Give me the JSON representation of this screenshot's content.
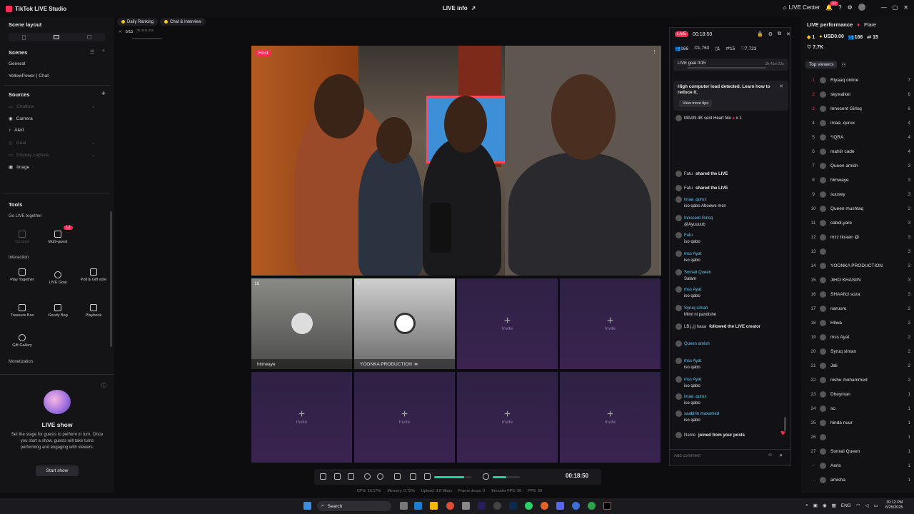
{
  "app": {
    "title": "TikTok LIVE Studio",
    "center_title": "LIVE info",
    "live_center": "LIVE Center",
    "notif_count": "11"
  },
  "left": {
    "scene_layout": "Scene layout",
    "scenes_title": "Scenes",
    "scenes": [
      "General",
      "YellowPower | Chat"
    ],
    "sources_title": "Sources",
    "sources": [
      {
        "label": "Chatbox",
        "dim": true
      },
      {
        "label": "Camera",
        "dim": false
      },
      {
        "label": "Alert",
        "dim": false
      },
      {
        "label": "Goal",
        "dim": true
      },
      {
        "label": "Display capture",
        "dim": true
      },
      {
        "label": "Image",
        "dim": false
      }
    ],
    "tools_title": "Tools",
    "go_live_together": "Go LIVE together",
    "cohost": "Co-host",
    "multiguest": "Multi-guest",
    "multiguest_badge": "12",
    "interaction": "Interaction",
    "play_together": "Play Together",
    "live_goal": "LIVE Goal",
    "poll_gift_vote": "Poll & Gift vote",
    "treasure_box": "Treasure Box",
    "goody_bag": "Goody Bag",
    "playbook": "Playbook",
    "gift_gallery": "Gift Gallery",
    "monetization": "Monetization",
    "live_show_title": "LIVE show",
    "live_show_desc": "Set the stage for guests to perform in turn. Once you start a show, guests will take turns performing and engaging with viewers.",
    "start_show": "Start show"
  },
  "top": {
    "daily_ranking": "Daily Ranking",
    "chat_interview": "Chat & Interview",
    "goal_progress": "0/15",
    "goal_time": "3h 41m 23s"
  },
  "video": {
    "host_label": "Host"
  },
  "guests": [
    {
      "name": "himwaye",
      "count": "16"
    },
    {
      "name": "YOONKA PRODUCTION 📼",
      "count": "6"
    }
  ],
  "invite_label": "Invite",
  "controls": {
    "timer": "00:18:50",
    "mic_level": 0.5,
    "speaker_level": 0.8
  },
  "stats": {
    "cpu": "CPU: 16.17%",
    "memory": "Memory: 0.72%",
    "upload": "Upload: 3.8 Mbps",
    "frame_drops": "Frame drops: 0",
    "encoder_fps": "Encoder FPS: 30",
    "fps": "FPS: 30"
  },
  "chat": {
    "live_badge": "LIVE",
    "timer": "00:18:50",
    "viewers": "166",
    "likes": "1,763",
    "stat3": "1",
    "shares": "15",
    "hearts": "7,723",
    "goal_label": "LIVE goal",
    "goal_progress": "0/15",
    "goal_time": "3h 41m 23s",
    "warning_title": "High computer load detected. Learn how to reduce it.",
    "view_tips": "View more tips",
    "gift_msg": "MAAN.4K sent Heart Me",
    "gift_count": "x 1",
    "messages": [
      {
        "name": "Fatu",
        "text": "shared the LIVE",
        "inline": true
      },
      {
        "name": "Fatu",
        "text": "shared the LIVE",
        "inline": true
      },
      {
        "name": "imaa .qurux",
        "text": "iso qabo Aboowe mcn",
        "inline": false
      },
      {
        "name": "Innocent Girlsq",
        "text": "@Ayuuuub",
        "inline": false
      },
      {
        "name": "Fatu",
        "text": "iso qabo",
        "inline": false
      },
      {
        "name": "mss Ayat",
        "text": "iso qabo",
        "inline": false
      },
      {
        "name": "Somali Queen",
        "text": "Salam",
        "inline": false
      },
      {
        "name": "mss Ayat",
        "text": "iso qabo",
        "inline": false
      },
      {
        "name": "Syruq siman",
        "text": "Mimi ni pandishe",
        "inline": false
      },
      {
        "name": "LB.jلj haaa",
        "text": "followed the LIVE creator",
        "inline": true
      },
      {
        "name": "Queen amish",
        "text": "",
        "inline": false
      },
      {
        "name": "mss Ayat",
        "text": "iso qabo",
        "inline": false
      },
      {
        "name": "mss Ayat",
        "text": "iso qabo",
        "inline": false
      },
      {
        "name": "imaa .qurux",
        "text": "iso qabo",
        "inline": false
      },
      {
        "name": "saabirin maxamed",
        "text": "iso qabo",
        "inline": false
      },
      {
        "name": "Name",
        "text": "joined from your posts",
        "inline": true
      }
    ],
    "add_comment": "Add comment"
  },
  "right": {
    "title": "LIVE performance",
    "flare": "Flare",
    "coins": "1",
    "usd": "USD0.00",
    "viewers": "166",
    "shares": "15",
    "likes": "7.7K",
    "top_viewers": "Top viewers",
    "ranking": [
      {
        "n": "1",
        "name": "Riyaaq online",
        "score": "7"
      },
      {
        "n": "2",
        "name": "skywalker",
        "score": "6"
      },
      {
        "n": "3",
        "name": "Innocent Girlsq",
        "score": "6"
      },
      {
        "n": "4",
        "name": "imaa .qurux",
        "score": "4"
      },
      {
        "n": "5",
        "name": "*IQRA",
        "score": "4"
      },
      {
        "n": "6",
        "name": "mahiir cade",
        "score": "4"
      },
      {
        "n": "7",
        "name": "Queen amish",
        "score": "3"
      },
      {
        "n": "8",
        "name": "himwaye",
        "score": "3"
      },
      {
        "n": "9",
        "name": "suusey",
        "score": "3"
      },
      {
        "n": "10",
        "name": "Queen mushtaq",
        "score": "3"
      },
      {
        "n": "11",
        "name": "cabdi.yare",
        "score": "3"
      },
      {
        "n": "12",
        "name": "mzz Ikraan @",
        "score": "3"
      },
      {
        "n": "13",
        "name": "",
        "score": "3"
      },
      {
        "n": "14",
        "name": "YOONKA PRODUCTION",
        "score": "3"
      },
      {
        "n": "15",
        "name": "JIHO KHASIIN",
        "score": "3"
      },
      {
        "n": "16",
        "name": "SHAAficI soza",
        "score": "3"
      },
      {
        "n": "17",
        "name": "naruuro",
        "score": "2"
      },
      {
        "n": "18",
        "name": "Hilwa",
        "score": "2"
      },
      {
        "n": "19",
        "name": "mss Ayat",
        "score": "2"
      },
      {
        "n": "20",
        "name": "Syruq siman",
        "score": "2"
      },
      {
        "n": "21",
        "name": "Jali",
        "score": "2"
      },
      {
        "n": "22",
        "name": "nishu mohammed",
        "score": "2"
      },
      {
        "n": "23",
        "name": "Dheyman",
        "score": "1"
      },
      {
        "n": "24",
        "name": "so",
        "score": "1"
      },
      {
        "n": "25",
        "name": "hinda nuur",
        "score": "1"
      },
      {
        "n": "26",
        "name": "",
        "score": "1"
      },
      {
        "n": "27",
        "name": "Somali Queen",
        "score": "1"
      },
      {
        "n": "-",
        "name": "Aerls",
        "score": "1"
      },
      {
        "n": "-",
        "name": "amisha",
        "score": "1"
      }
    ]
  },
  "taskbar": {
    "search": "Search",
    "lang": "ENG",
    "time": "10:12 PM",
    "date": "6/25/2025"
  }
}
